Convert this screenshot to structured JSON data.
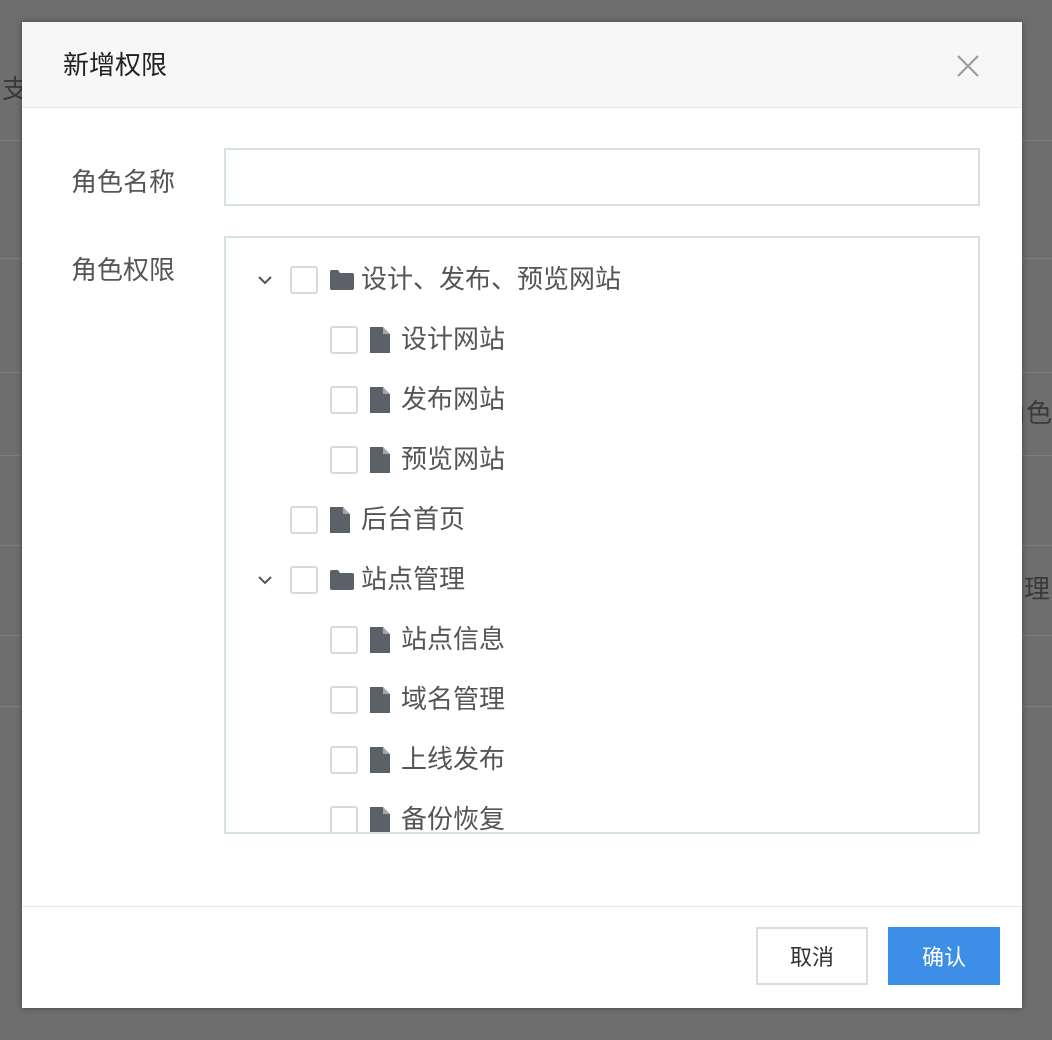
{
  "background": {
    "fragments": [
      "支",
      "角色",
      "管理"
    ]
  },
  "dialog": {
    "title": "新增权限",
    "close_icon": "close-icon"
  },
  "form": {
    "role_name_label": "角色名称",
    "role_name_value": "",
    "role_permission_label": "角色权限"
  },
  "tree": {
    "nodes": [
      {
        "label": "设计、发布、预览网站",
        "type": "folder",
        "level": 0,
        "expanded": true,
        "checked": false
      },
      {
        "label": "设计网站",
        "type": "file",
        "level": 1,
        "checked": false
      },
      {
        "label": "发布网站",
        "type": "file",
        "level": 1,
        "checked": false
      },
      {
        "label": "预览网站",
        "type": "file",
        "level": 1,
        "checked": false
      },
      {
        "label": "后台首页",
        "type": "file",
        "level": 0,
        "checked": false
      },
      {
        "label": "站点管理",
        "type": "folder",
        "level": 0,
        "expanded": true,
        "checked": false
      },
      {
        "label": "站点信息",
        "type": "file",
        "level": 1,
        "checked": false
      },
      {
        "label": "域名管理",
        "type": "file",
        "level": 1,
        "checked": false
      },
      {
        "label": "上线发布",
        "type": "file",
        "level": 1,
        "checked": false
      },
      {
        "label": "备份恢复",
        "type": "file",
        "level": 1,
        "checked": false
      }
    ]
  },
  "footer": {
    "cancel_label": "取消",
    "confirm_label": "确认"
  },
  "colors": {
    "primary": "#3c8ee6",
    "icon": "#5a6169",
    "overlay": "#6e6e6e"
  }
}
